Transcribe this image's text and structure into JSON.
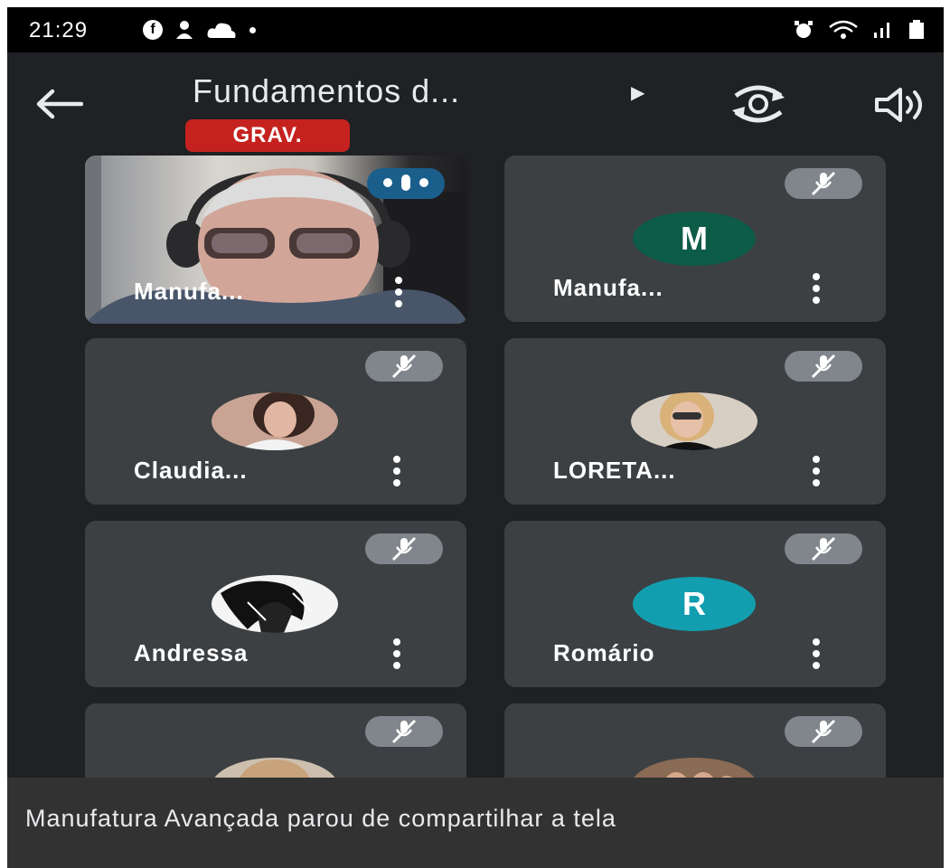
{
  "status_bar": {
    "time": "21:29",
    "left_icons": [
      "facebook-icon",
      "person-icon",
      "cloud-icon",
      "dot-icon"
    ],
    "right_icons": [
      "alarm-icon",
      "wifi-icon",
      "signal-icon",
      "battery-icon"
    ]
  },
  "meeting": {
    "title": "Fundamentos d...",
    "recording_badge": "GRAV."
  },
  "participants": [
    {
      "name": "Manufa...",
      "type": "video",
      "state": "speaking"
    },
    {
      "name": "Manufa...",
      "type": "letter",
      "initial": "M",
      "avatar_color": "#0d5c47",
      "state": "muted"
    },
    {
      "name": "Claudia...",
      "type": "photo",
      "state": "muted"
    },
    {
      "name": "LORETA...",
      "type": "photo",
      "state": "muted"
    },
    {
      "name": "Andressa",
      "type": "photo",
      "state": "muted"
    },
    {
      "name": "Romário",
      "type": "letter",
      "initial": "R",
      "avatar_color": "#129eaf",
      "state": "muted"
    },
    {
      "name": "",
      "type": "photo",
      "state": "muted"
    },
    {
      "name": "",
      "type": "photo",
      "state": "muted"
    }
  ],
  "toast": {
    "message": "Manufatura Avançada parou de compartilhar a tela"
  },
  "colors": {
    "background": "#202124",
    "tile": "#3c4043",
    "recording": "#c5221f",
    "speaking_indicator": "#1a5f8c"
  }
}
